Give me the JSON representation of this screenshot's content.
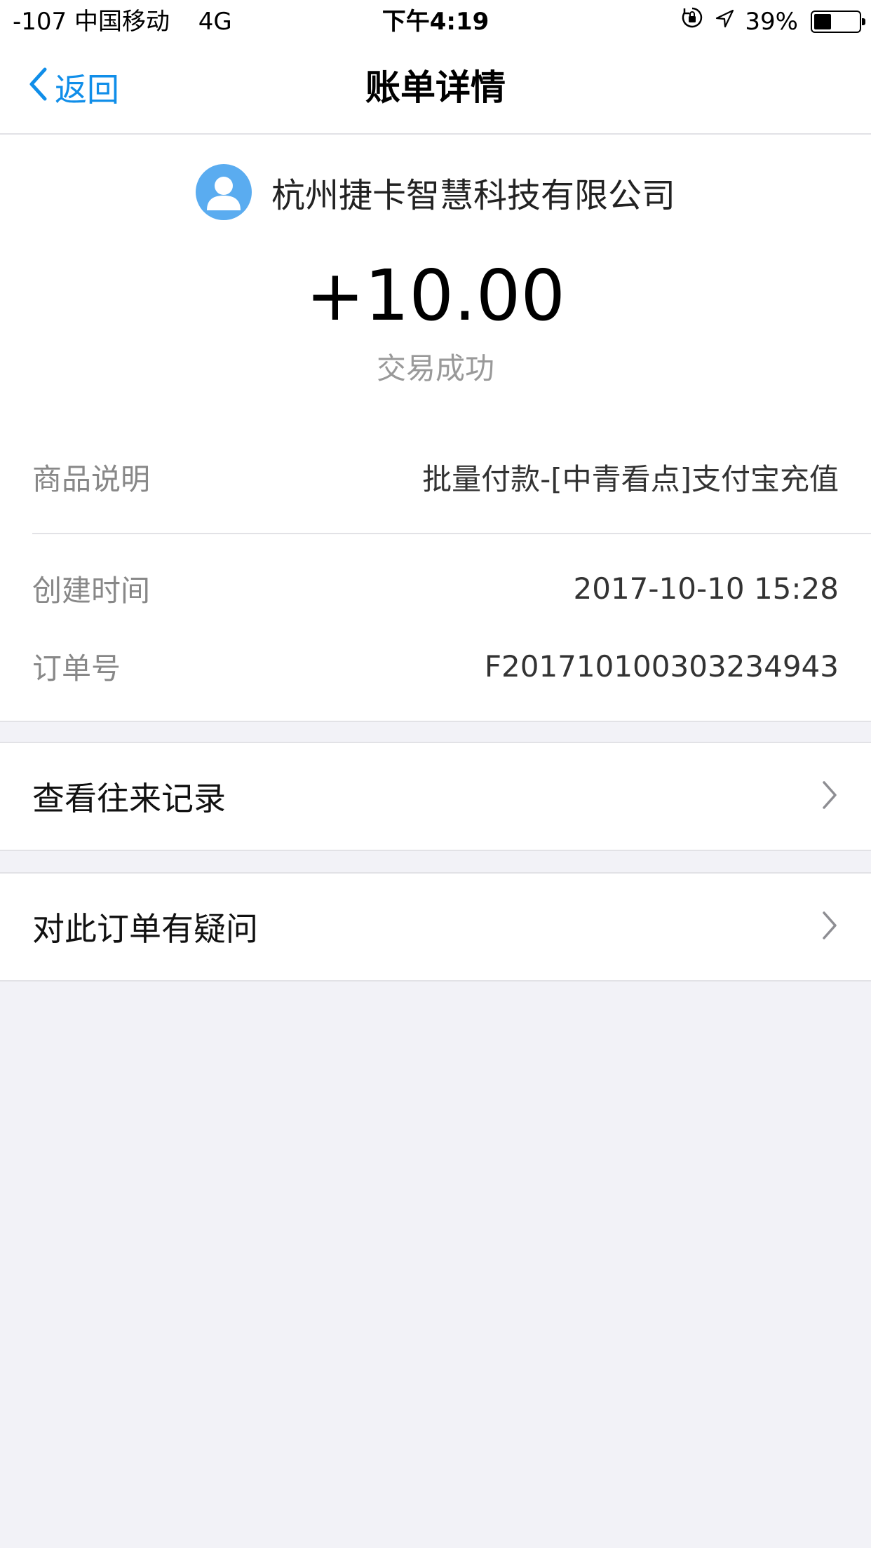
{
  "status_bar": {
    "signal": "-107",
    "carrier": "中国移动",
    "network": "4G",
    "time": "下午4:19",
    "battery_percent": "39%",
    "battery_level": 0.39,
    "icons": [
      "orientation-lock-icon",
      "location-arrow-icon",
      "battery-icon"
    ]
  },
  "nav": {
    "back_label": "返回",
    "title": "账单详情",
    "accent_color": "#108ee9"
  },
  "bill": {
    "payer_name": "杭州捷卡智慧科技有限公司",
    "amount": "+10.00",
    "status": "交易成功",
    "avatar_color": "#5aacf0",
    "details": [
      {
        "label": "商品说明",
        "value": "批量付款-[中青看点]支付宝充值"
      },
      {
        "label": "创建时间",
        "value": "2017-10-10 15:28"
      },
      {
        "label": "订单号",
        "value": "F2017101003032349​43"
      }
    ]
  },
  "actions": [
    {
      "label": "查看往来记录"
    },
    {
      "label": "对此订单有疑问"
    }
  ]
}
